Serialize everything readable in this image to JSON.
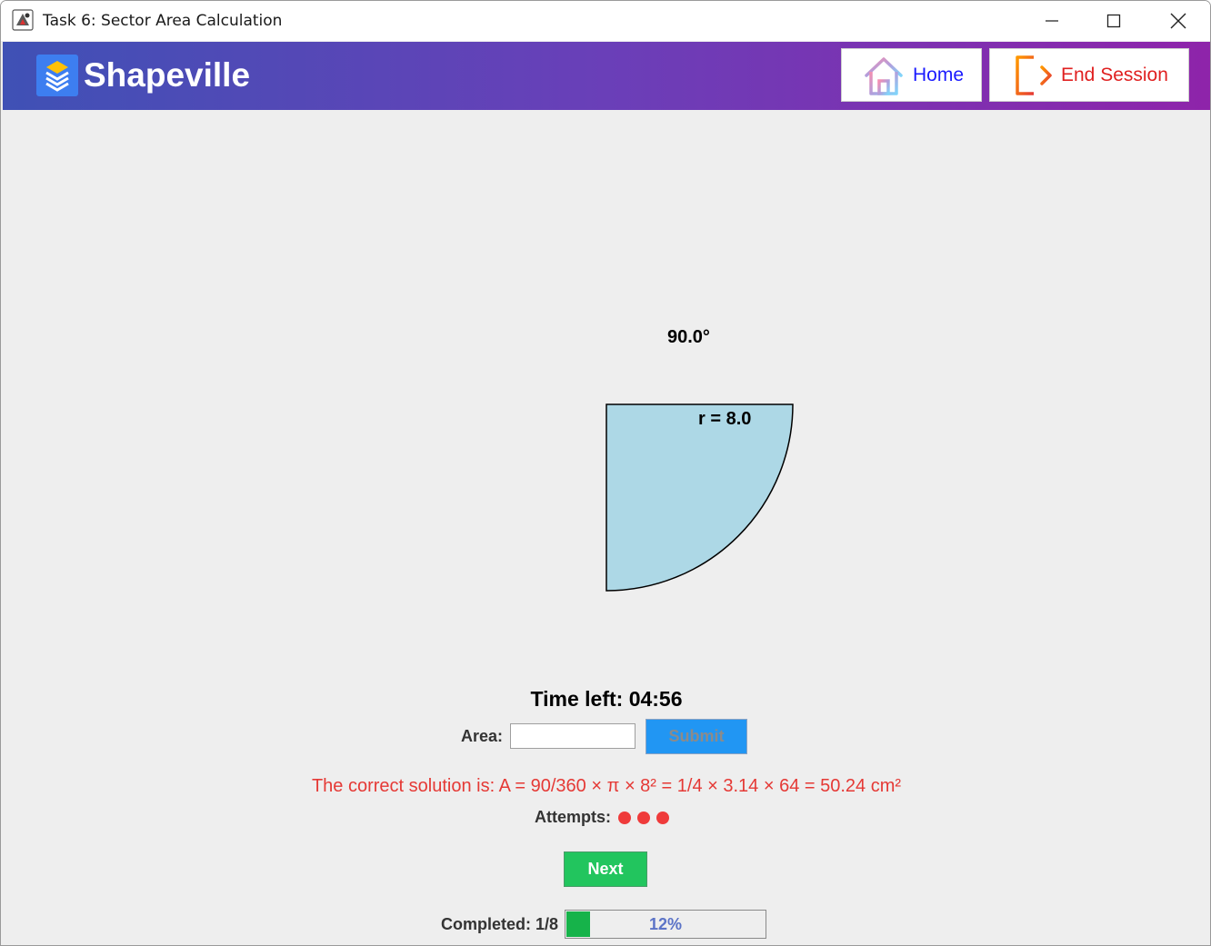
{
  "window": {
    "title": "Task 6: Sector Area Calculation"
  },
  "header": {
    "brand": "Shapeville",
    "home_label": "Home",
    "end_session_label": "End Session"
  },
  "shape": {
    "angle_label": "90.0°",
    "radius_label": "r = 8.0",
    "angle_degrees": 90,
    "fill_color": "#add8e6"
  },
  "task": {
    "timer": "Time left: 04:56",
    "area_label": "Area:",
    "area_value": "",
    "submit_label": "Submit",
    "solution": "The correct solution is: A = 90/360 × π × 8² = 1/4 × 3.14 × 64 = 50.24 cm²",
    "attempts_label": "Attempts:",
    "attempts_used": 3,
    "next_label": "Next"
  },
  "progress": {
    "label": "Completed: 1/8",
    "percent_text": "12%",
    "fraction": 0.125
  },
  "colors": {
    "header_start": "#3f51b5",
    "header_end": "#8e24aa",
    "submit": "#2196f3",
    "next": "#22c55e",
    "error": "#e53935",
    "progress_fill": "#16b34a"
  }
}
